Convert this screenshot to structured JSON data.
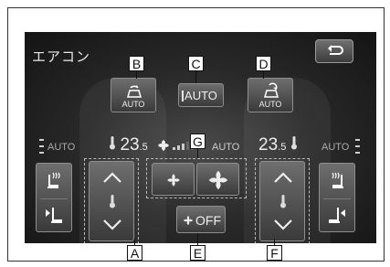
{
  "screen": {
    "title": "エアコン"
  },
  "buttons": {
    "auto_label": "AUTO",
    "off_label": "OFF",
    "recirc_sub": "AUTO",
    "fresh_sub": "AUTO"
  },
  "temps": {
    "left": {
      "value": "23",
      "decimal": ".5"
    },
    "right": {
      "value": "23",
      "decimal": ".5"
    }
  },
  "side": {
    "left_auto": "AUTO",
    "right_auto": "AUTO",
    "center_auto": "AUTO"
  },
  "callouts": {
    "A": "A",
    "B": "B",
    "C": "C",
    "D": "D",
    "E": "E",
    "F": "F",
    "G": "G"
  }
}
